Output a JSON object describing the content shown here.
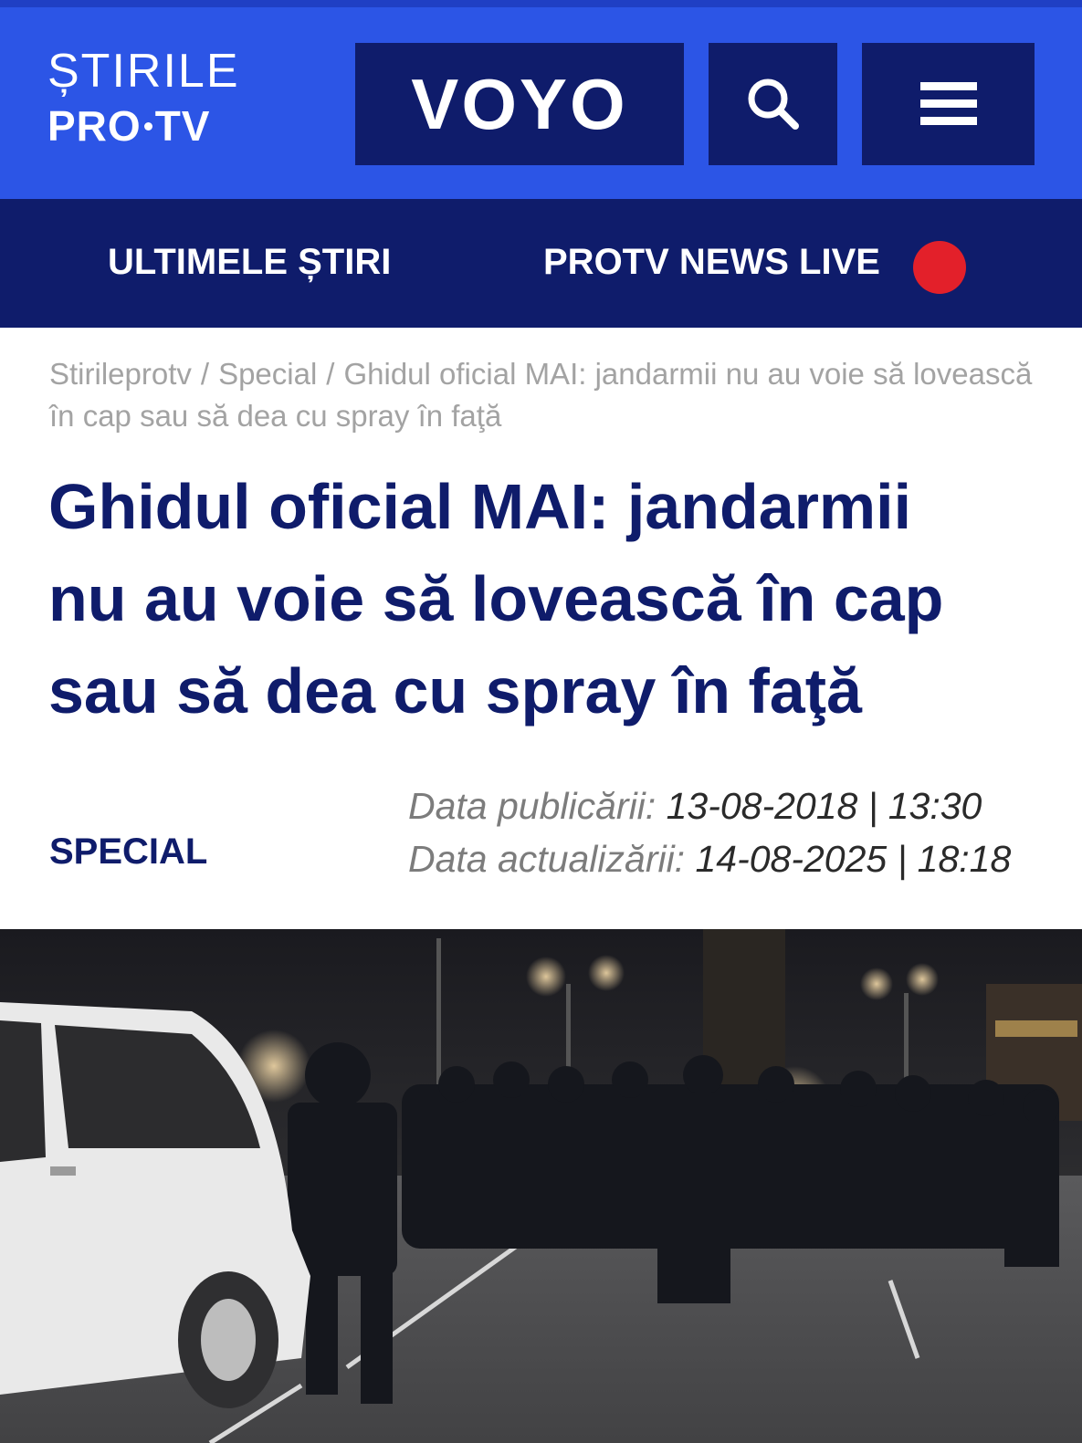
{
  "header": {
    "logo_line1": "ȘTIRILE",
    "logo_pro": "PRO",
    "logo_tv": "TV",
    "voyo_label": "VOYO"
  },
  "nav": {
    "latest": "ULTIMELE ȘTIRI",
    "live": "PROTV NEWS LIVE"
  },
  "breadcrumb": {
    "items": [
      "Stirileprotv",
      "Special",
      "Ghidul oficial MAI: jandarmii nu au voie să lovească în cap sau să dea cu spray în faţă"
    ],
    "separator": "/"
  },
  "article": {
    "title_lines": [
      "Ghidul oficial MAI: jandarmii",
      "nu au voie să lovească în cap",
      "sau să dea cu spray în faţă"
    ],
    "category": "SPECIAL",
    "published_label": "Data publicării:",
    "published_value": "13-08-2018 | 13:30",
    "updated_label": "Data actualizării:",
    "updated_value": "14-08-2025 | 18:18"
  },
  "colors": {
    "brand_blue": "#2c55e6",
    "navy": "#0f1c6b",
    "live_red": "#e3202a"
  },
  "icons": {
    "search": "search-icon",
    "menu": "hamburger-menu-icon",
    "live": "live-indicator-icon"
  }
}
